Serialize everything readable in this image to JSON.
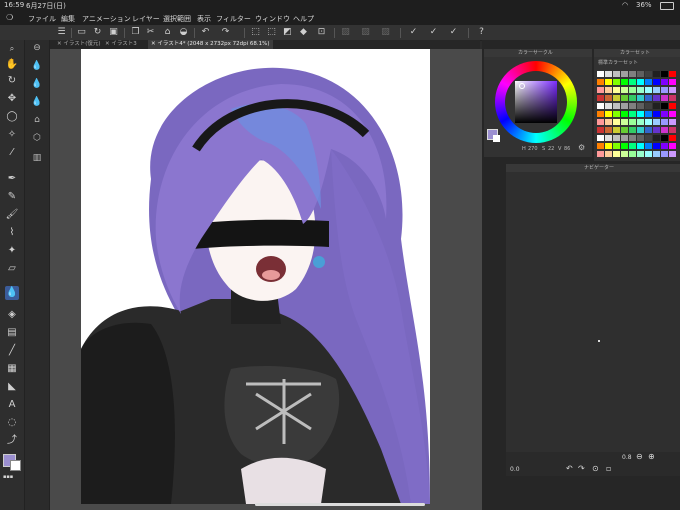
{
  "status_bar": {
    "time": "16:59",
    "date": "6月27日(日)",
    "battery": "36%"
  },
  "menu": [
    "ファイル",
    "編集",
    "アニメーション",
    "レイヤー",
    "選択範囲",
    "表示",
    "フィルター",
    "ウィンドウ",
    "ヘルプ"
  ],
  "tabs": [
    {
      "label": "イラスト(復元)",
      "active": false
    },
    {
      "label": "イラスト3",
      "active": false
    },
    {
      "label": "イラスト4* (2048 x 2732px 72dpi 68.1%)",
      "active": true
    }
  ],
  "panels": {
    "color_circle": {
      "title": "カラーサークル",
      "h": "270",
      "s": "22",
      "v": "86"
    },
    "color_set": {
      "title": "カラーセット",
      "set_name": "標準カラーセット"
    },
    "navigator": {
      "title": "ナビゲーター",
      "zoom": "0.8"
    }
  },
  "colors": {
    "main_color": "#9b8fd0",
    "sub_color": "#ffffff",
    "active_tool": "#3b5c9a"
  },
  "icons": {
    "tools": [
      "zoom-icon",
      "move-icon",
      "hand-icon",
      "rotate-icon",
      "lasso-icon",
      "magic-wand-icon",
      "eyedropper-icon",
      "pen-icon",
      "pencil-icon",
      "brush-icon",
      "airbrush-icon",
      "decoration-icon",
      "eraser-icon",
      "blend-icon",
      "fill-icon",
      "gradient-icon",
      "figure-icon",
      "frame-icon",
      "ruler-icon",
      "text-icon",
      "balloon-icon",
      "correct-line-icon"
    ]
  }
}
